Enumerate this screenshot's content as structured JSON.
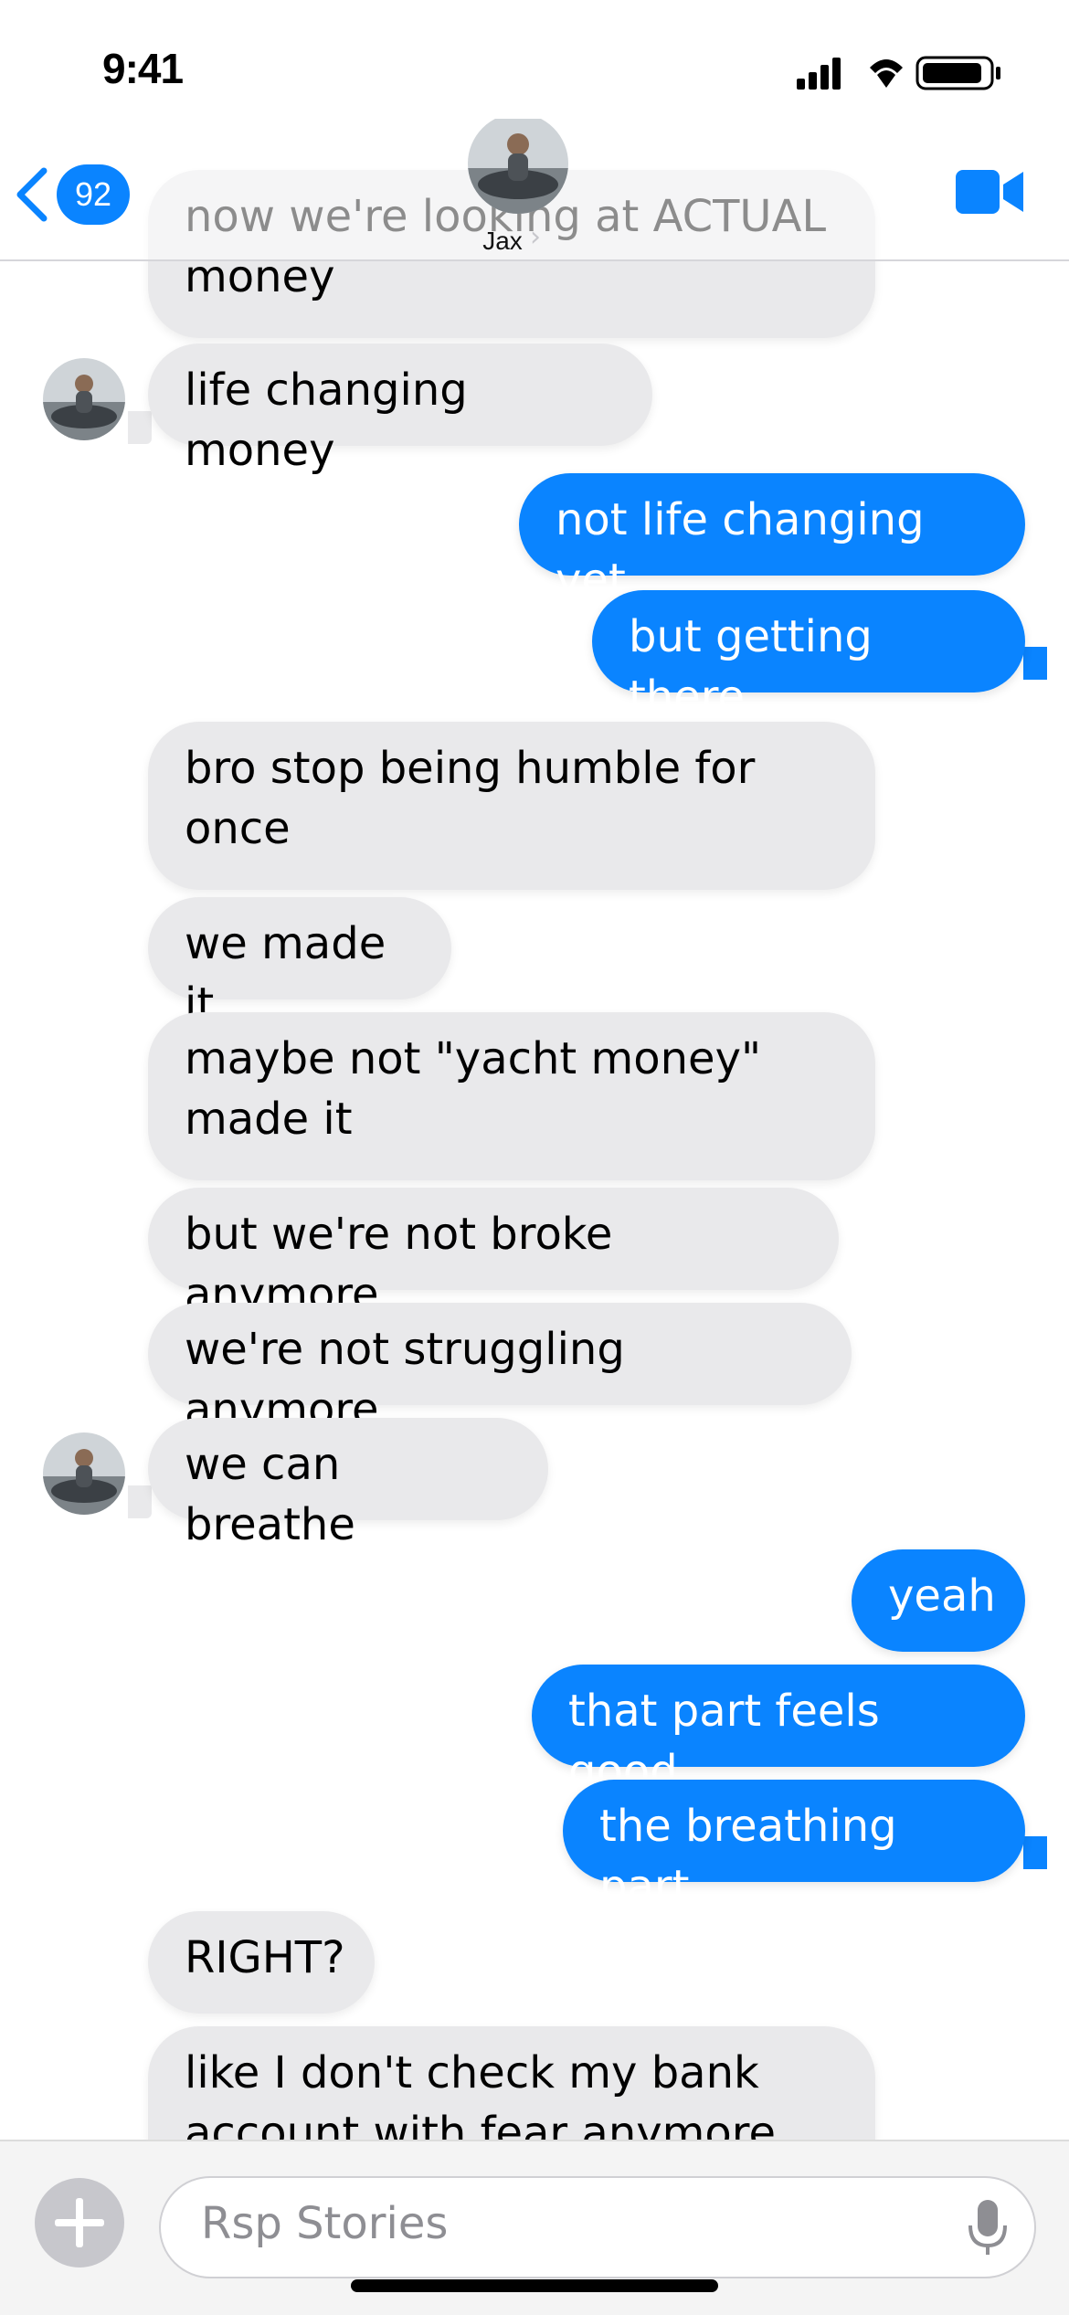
{
  "status_bar": {
    "time": "9:41"
  },
  "header": {
    "back_count": "92",
    "contact_name": "Jax",
    "accent": "#0a84ff"
  },
  "messages": [
    {
      "from": "them",
      "text": "now we're looking at ACTUAL\nmoney"
    },
    {
      "from": "them",
      "text": "life changing money"
    },
    {
      "from": "me",
      "text": "not life changing yet"
    },
    {
      "from": "me",
      "text": "but getting there"
    },
    {
      "from": "them",
      "text": "bro stop being humble for\nonce"
    },
    {
      "from": "them",
      "text": "we made it"
    },
    {
      "from": "them",
      "text": "maybe not \"yacht money\"\nmade it"
    },
    {
      "from": "them",
      "text": "but we're not broke anymore"
    },
    {
      "from": "them",
      "text": "we're not struggling anymore"
    },
    {
      "from": "them",
      "text": "we can breathe"
    },
    {
      "from": "me",
      "text": "yeah"
    },
    {
      "from": "me",
      "text": "that part feels good"
    },
    {
      "from": "me",
      "text": "the breathing part"
    },
    {
      "from": "them",
      "text": "RIGHT?"
    },
    {
      "from": "them",
      "text": "like I don't check my bank\naccount with fear anymore"
    }
  ],
  "composer": {
    "placeholder": "Rsp Stories"
  },
  "icons": {
    "back": "chevron-left-icon",
    "video": "video-camera-icon",
    "plus": "plus-icon",
    "mic": "microphone-icon",
    "signal": "signal-icon",
    "wifi": "wifi-icon",
    "battery": "battery-icon"
  }
}
